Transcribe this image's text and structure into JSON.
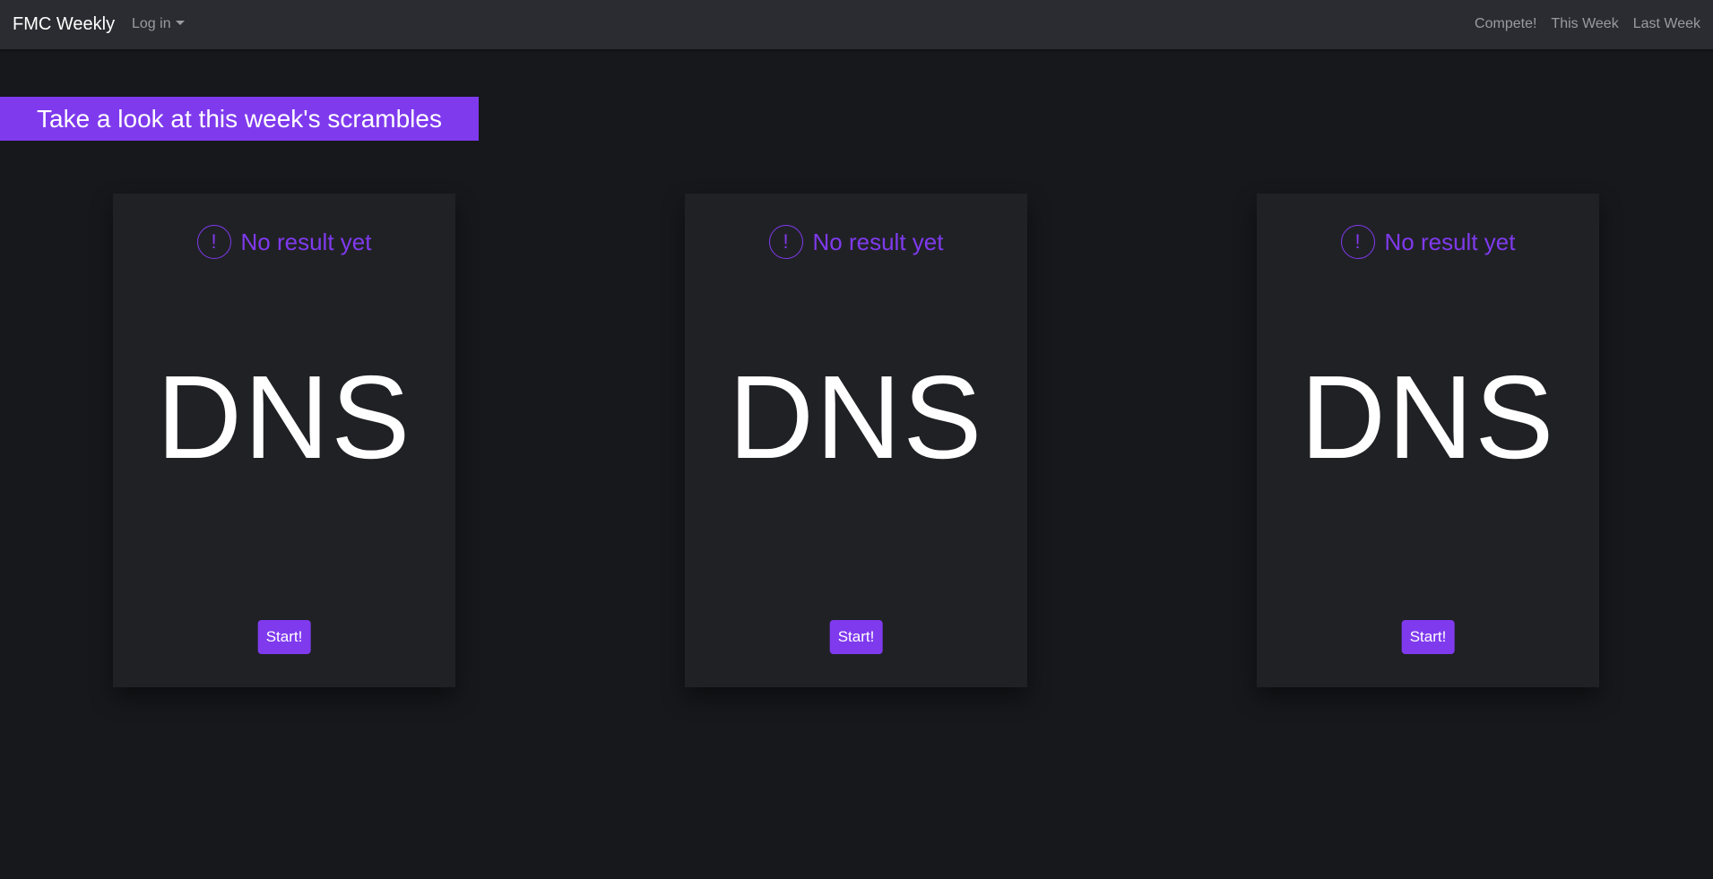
{
  "navbar": {
    "brand": "FMC Weekly",
    "login_label": "Log in",
    "links": [
      "Compete!",
      "This Week",
      "Last Week"
    ]
  },
  "banner": {
    "text": "Take a look at this week's scrambles"
  },
  "cards": [
    {
      "status": "No result yet",
      "status_icon": "exclamation-circle-icon",
      "result": "DNS",
      "button_label": "Start!"
    },
    {
      "status": "No result yet",
      "status_icon": "exclamation-circle-icon",
      "result": "DNS",
      "button_label": "Start!"
    },
    {
      "status": "No result yet",
      "status_icon": "exclamation-circle-icon",
      "result": "DNS",
      "button_label": "Start!"
    }
  ],
  "colors": {
    "accent": "#7f3aee",
    "background": "#17181c",
    "navbar": "#2b2c31",
    "card": "#202125"
  }
}
